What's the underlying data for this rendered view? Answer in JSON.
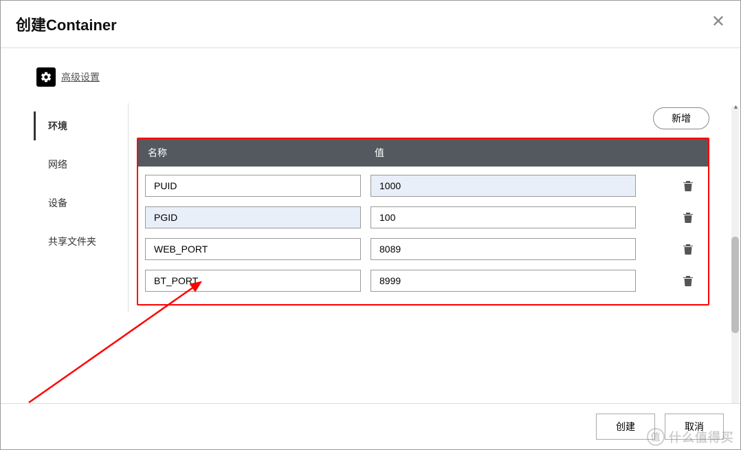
{
  "modal": {
    "title": "创建Container",
    "advanced_settings_label": "高级设置"
  },
  "tabs": [
    {
      "label": "环境",
      "active": true
    },
    {
      "label": "网络",
      "active": false
    },
    {
      "label": "设备",
      "active": false
    },
    {
      "label": "共享文件夹",
      "active": false
    }
  ],
  "env_panel": {
    "add_button_label": "新增",
    "columns": {
      "name": "名称",
      "value": "值"
    },
    "rows": [
      {
        "name": "PUID",
        "value": "1000",
        "name_highlight": false,
        "value_highlight": true
      },
      {
        "name": "PGID",
        "value": "100",
        "name_highlight": true,
        "value_highlight": false
      },
      {
        "name": "WEB_PORT",
        "value": "8089",
        "name_highlight": false,
        "value_highlight": false
      },
      {
        "name": "BT_PORT",
        "value": "8999",
        "name_highlight": false,
        "value_highlight": false
      }
    ]
  },
  "footer": {
    "create_label": "创建",
    "cancel_label": "取消"
  },
  "watermark": "什么值得买"
}
